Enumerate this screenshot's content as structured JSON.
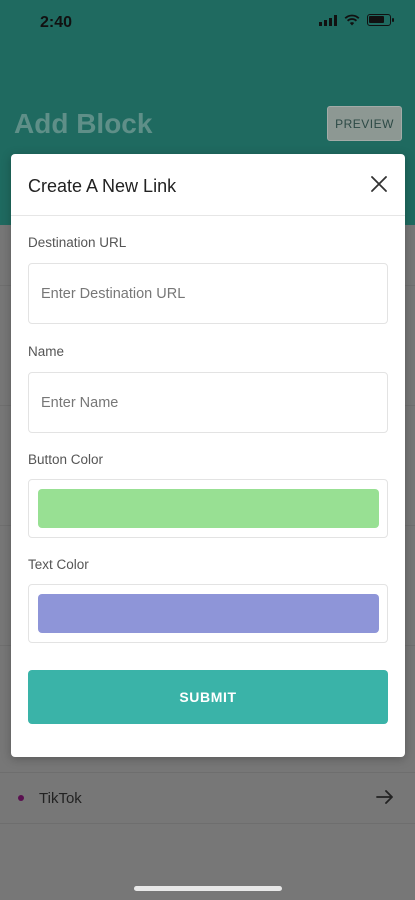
{
  "status_bar": {
    "time": "2:40"
  },
  "screen": {
    "title": "Add Block",
    "preview_label": "PREVIEW",
    "list_items": [
      {
        "label": "TikTok"
      }
    ]
  },
  "modal": {
    "title": "Create A New Link",
    "fields": {
      "destination_url": {
        "label": "Destination URL",
        "placeholder": "Enter Destination URL",
        "value": ""
      },
      "name": {
        "label": "Name",
        "placeholder": "Enter Name",
        "value": ""
      },
      "button_color": {
        "label": "Button Color",
        "value": "#98e093"
      },
      "text_color": {
        "label": "Text Color",
        "value": "#8e95d8"
      }
    },
    "submit_label": "SUBMIT"
  },
  "colors": {
    "header_bg": "#1f6a60",
    "accent": "#3ab3a8",
    "tiktok_dot": "#5a1050"
  },
  "icons": {
    "close": "close-icon",
    "arrow": "arrow-right-icon"
  }
}
